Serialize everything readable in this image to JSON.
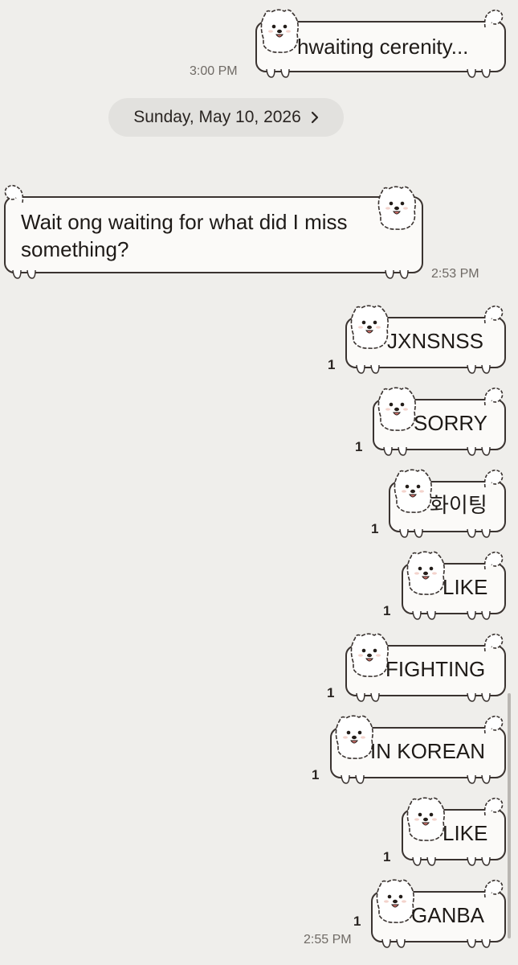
{
  "date_divider": {
    "label": "Sunday, May 10, 2026",
    "chevron_icon": "chevron-right-icon"
  },
  "messages": [
    {
      "direction": "sent",
      "text": "hwaiting cerenity...",
      "time": "3:00 PM",
      "unread": ""
    },
    {
      "direction": "received",
      "text": "Wait ong waiting for what did I miss something?",
      "line1": "Wait ong waiting for what did I miss",
      "line2": "something?",
      "time": "2:53 PM",
      "unread": ""
    },
    {
      "direction": "sent",
      "text": "JXNSNSS",
      "time": "",
      "unread": "1"
    },
    {
      "direction": "sent",
      "text": "SORRY",
      "time": "",
      "unread": "1"
    },
    {
      "direction": "sent",
      "text": "화이팅",
      "time": "",
      "unread": "1"
    },
    {
      "direction": "sent",
      "text": "LIKE",
      "time": "",
      "unread": "1"
    },
    {
      "direction": "sent",
      "text": "FIGHTING",
      "time": "",
      "unread": "1"
    },
    {
      "direction": "sent",
      "text": "IN KOREAN",
      "time": "",
      "unread": "1"
    },
    {
      "direction": "sent",
      "text": "LIKE",
      "time": "",
      "unread": "1"
    },
    {
      "direction": "sent",
      "text": "GANBA",
      "time": "2:55 PM",
      "unread": "1"
    }
  ],
  "bubble_icon": "pomeranian-dog-icon",
  "colors": {
    "background": "#efeeeb",
    "bubble": "#fbfaf8",
    "outline": "#3a3330",
    "pill": "#e2e1de"
  }
}
